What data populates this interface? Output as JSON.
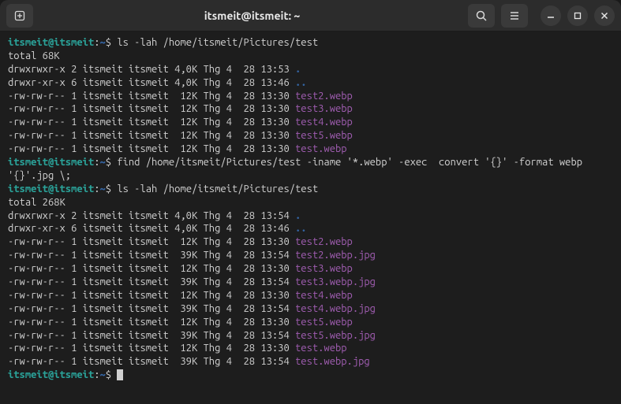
{
  "titlebar": {
    "title": "itsmeit@itsmeit: ~"
  },
  "prompt": {
    "user_host": "itsmeit@itsmeit",
    "colon": ":",
    "path": "~",
    "symbol": "$"
  },
  "commands": {
    "ls1": "ls -lah /home/itsmeit/Pictures/test",
    "find": "find /home/itsmeit/Pictures/test -iname '*.webp' -exec  convert '{}' -format webp '{}'.jpg \\;",
    "ls2": "ls -lah /home/itsmeit/Pictures/test"
  },
  "output1": {
    "total": "total 68K",
    "rows": [
      {
        "perms": "drwxrwxr-x",
        "links": "2",
        "owner": "itsmeit",
        "group": "itsmeit",
        "size": "4,0K",
        "month": "Thg 4",
        "day": " 28",
        "time": "13:53",
        "name": ".",
        "color": "blue"
      },
      {
        "perms": "drwxr-xr-x",
        "links": "6",
        "owner": "itsmeit",
        "group": "itsmeit",
        "size": "4,0K",
        "month": "Thg 4",
        "day": " 28",
        "time": "13:46",
        "name": "..",
        "color": "blue"
      },
      {
        "perms": "-rw-rw-r--",
        "links": "1",
        "owner": "itsmeit",
        "group": "itsmeit",
        "size": " 12K",
        "month": "Thg 4",
        "day": " 28",
        "time": "13:30",
        "name": "test2.webp",
        "color": "purple"
      },
      {
        "perms": "-rw-rw-r--",
        "links": "1",
        "owner": "itsmeit",
        "group": "itsmeit",
        "size": " 12K",
        "month": "Thg 4",
        "day": " 28",
        "time": "13:30",
        "name": "test3.webp",
        "color": "purple"
      },
      {
        "perms": "-rw-rw-r--",
        "links": "1",
        "owner": "itsmeit",
        "group": "itsmeit",
        "size": " 12K",
        "month": "Thg 4",
        "day": " 28",
        "time": "13:30",
        "name": "test4.webp",
        "color": "purple"
      },
      {
        "perms": "-rw-rw-r--",
        "links": "1",
        "owner": "itsmeit",
        "group": "itsmeit",
        "size": " 12K",
        "month": "Thg 4",
        "day": " 28",
        "time": "13:30",
        "name": "test5.webp",
        "color": "purple"
      },
      {
        "perms": "-rw-rw-r--",
        "links": "1",
        "owner": "itsmeit",
        "group": "itsmeit",
        "size": " 12K",
        "month": "Thg 4",
        "day": " 28",
        "time": "13:30",
        "name": "test.webp",
        "color": "purple"
      }
    ]
  },
  "output2": {
    "total": "total 268K",
    "rows": [
      {
        "perms": "drwxrwxr-x",
        "links": "2",
        "owner": "itsmeit",
        "group": "itsmeit",
        "size": "4,0K",
        "month": "Thg 4",
        "day": " 28",
        "time": "13:54",
        "name": ".",
        "color": "blue"
      },
      {
        "perms": "drwxr-xr-x",
        "links": "6",
        "owner": "itsmeit",
        "group": "itsmeit",
        "size": "4,0K",
        "month": "Thg 4",
        "day": " 28",
        "time": "13:46",
        "name": "..",
        "color": "blue"
      },
      {
        "perms": "-rw-rw-r--",
        "links": "1",
        "owner": "itsmeit",
        "group": "itsmeit",
        "size": " 12K",
        "month": "Thg 4",
        "day": " 28",
        "time": "13:30",
        "name": "test2.webp",
        "color": "purple"
      },
      {
        "perms": "-rw-rw-r--",
        "links": "1",
        "owner": "itsmeit",
        "group": "itsmeit",
        "size": " 39K",
        "month": "Thg 4",
        "day": " 28",
        "time": "13:54",
        "name": "test2.webp.jpg",
        "color": "purple"
      },
      {
        "perms": "-rw-rw-r--",
        "links": "1",
        "owner": "itsmeit",
        "group": "itsmeit",
        "size": " 12K",
        "month": "Thg 4",
        "day": " 28",
        "time": "13:30",
        "name": "test3.webp",
        "color": "purple"
      },
      {
        "perms": "-rw-rw-r--",
        "links": "1",
        "owner": "itsmeit",
        "group": "itsmeit",
        "size": " 39K",
        "month": "Thg 4",
        "day": " 28",
        "time": "13:54",
        "name": "test3.webp.jpg",
        "color": "purple"
      },
      {
        "perms": "-rw-rw-r--",
        "links": "1",
        "owner": "itsmeit",
        "group": "itsmeit",
        "size": " 12K",
        "month": "Thg 4",
        "day": " 28",
        "time": "13:30",
        "name": "test4.webp",
        "color": "purple"
      },
      {
        "perms": "-rw-rw-r--",
        "links": "1",
        "owner": "itsmeit",
        "group": "itsmeit",
        "size": " 39K",
        "month": "Thg 4",
        "day": " 28",
        "time": "13:54",
        "name": "test4.webp.jpg",
        "color": "purple"
      },
      {
        "perms": "-rw-rw-r--",
        "links": "1",
        "owner": "itsmeit",
        "group": "itsmeit",
        "size": " 12K",
        "month": "Thg 4",
        "day": " 28",
        "time": "13:30",
        "name": "test5.webp",
        "color": "purple"
      },
      {
        "perms": "-rw-rw-r--",
        "links": "1",
        "owner": "itsmeit",
        "group": "itsmeit",
        "size": " 39K",
        "month": "Thg 4",
        "day": " 28",
        "time": "13:54",
        "name": "test5.webp.jpg",
        "color": "purple"
      },
      {
        "perms": "-rw-rw-r--",
        "links": "1",
        "owner": "itsmeit",
        "group": "itsmeit",
        "size": " 12K",
        "month": "Thg 4",
        "day": " 28",
        "time": "13:30",
        "name": "test.webp",
        "color": "purple"
      },
      {
        "perms": "-rw-rw-r--",
        "links": "1",
        "owner": "itsmeit",
        "group": "itsmeit",
        "size": " 39K",
        "month": "Thg 4",
        "day": " 28",
        "time": "13:54",
        "name": "test.webp.jpg",
        "color": "purple"
      }
    ]
  }
}
